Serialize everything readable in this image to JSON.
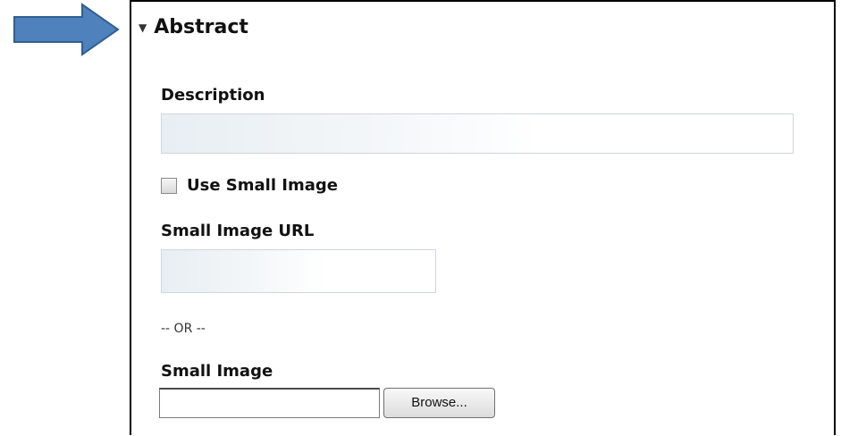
{
  "section": {
    "title": "Abstract",
    "toggle_icon": "triangle-down-icon"
  },
  "fields": {
    "description": {
      "label": "Description",
      "value": ""
    },
    "use_small_image": {
      "label": "Use Small Image",
      "checked": false
    },
    "small_image_url": {
      "label": "Small Image URL",
      "value": ""
    },
    "or_separator": "-- OR --",
    "small_image": {
      "label": "Small Image",
      "file_value": "",
      "browse_label": "Browse..."
    }
  },
  "annotations": {
    "pointer": "arrow-right-icon",
    "arrow_color": "#4f81bd"
  }
}
